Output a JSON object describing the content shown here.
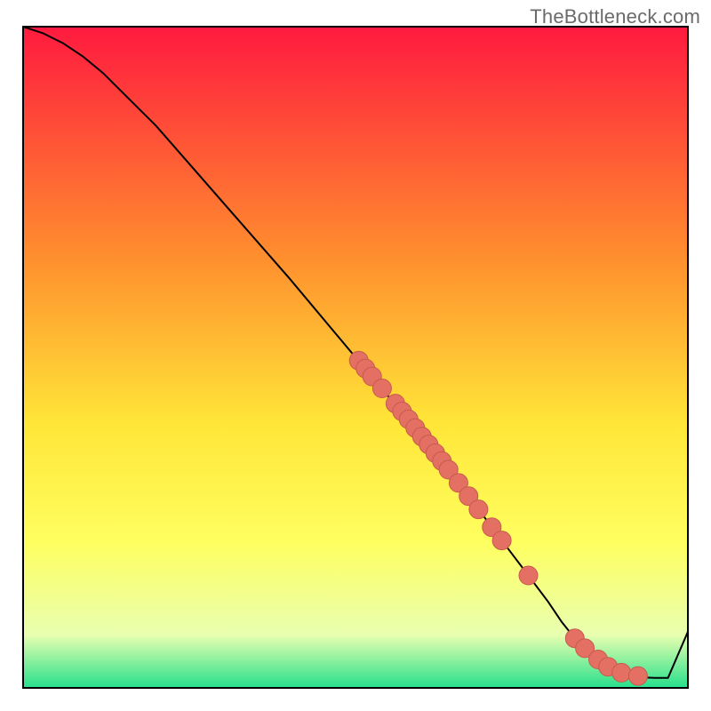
{
  "attribution": "TheBottleneck.com",
  "colors": {
    "frame": "#000000",
    "curve": "#000000",
    "dot_fill": "#e37062",
    "dot_stroke": "#c65a4e",
    "gradient_top": "#ff1a3f",
    "gradient_mid1": "#ff8f2e",
    "gradient_mid2": "#ffe638",
    "gradient_mid3": "#ffff60",
    "gradient_mid4": "#e8ffb0",
    "gradient_bottom": "#26e08c"
  },
  "chart_data": {
    "type": "line",
    "title": "",
    "xlabel": "",
    "ylabel": "",
    "xlim": [
      0,
      100
    ],
    "ylim": [
      0,
      100
    ],
    "grid": false,
    "legend": false,
    "series": [
      {
        "name": "curve",
        "x": [
          0,
          3,
          6,
          9,
          12,
          20,
          30,
          40,
          50,
          55,
          60,
          64,
          67,
          70,
          73,
          76,
          79,
          81,
          83,
          85,
          87,
          89,
          91,
          93,
          95,
          97,
          100
        ],
        "y": [
          100,
          99,
          97.5,
          95.5,
          93,
          85,
          73.5,
          62,
          50,
          44,
          38,
          33,
          29,
          25,
          21,
          17,
          13,
          10,
          7.5,
          5.5,
          4,
          2.8,
          2.0,
          1.6,
          1.5,
          1.5,
          8.5
        ]
      }
    ],
    "dots": [
      {
        "x": 50.5,
        "y": 49.5
      },
      {
        "x": 51.5,
        "y": 48.3
      },
      {
        "x": 52.5,
        "y": 47.1
      },
      {
        "x": 54.0,
        "y": 45.3
      },
      {
        "x": 56.0,
        "y": 43.0
      },
      {
        "x": 57.0,
        "y": 41.8
      },
      {
        "x": 58.0,
        "y": 40.6
      },
      {
        "x": 59.0,
        "y": 39.3
      },
      {
        "x": 60.0,
        "y": 38.0
      },
      {
        "x": 61.0,
        "y": 36.8
      },
      {
        "x": 62.0,
        "y": 35.5
      },
      {
        "x": 63.0,
        "y": 34.3
      },
      {
        "x": 64.0,
        "y": 33.0
      },
      {
        "x": 65.5,
        "y": 31.0
      },
      {
        "x": 67.0,
        "y": 29.0
      },
      {
        "x": 68.5,
        "y": 27.0
      },
      {
        "x": 70.5,
        "y": 24.3
      },
      {
        "x": 72.0,
        "y": 22.3
      },
      {
        "x": 76.0,
        "y": 17.0
      },
      {
        "x": 83.0,
        "y": 7.5
      },
      {
        "x": 84.5,
        "y": 6.0
      },
      {
        "x": 86.5,
        "y": 4.3
      },
      {
        "x": 88.0,
        "y": 3.2
      },
      {
        "x": 90.0,
        "y": 2.3
      },
      {
        "x": 92.5,
        "y": 1.8
      }
    ],
    "dot_radius_value_units": 1.4
  }
}
